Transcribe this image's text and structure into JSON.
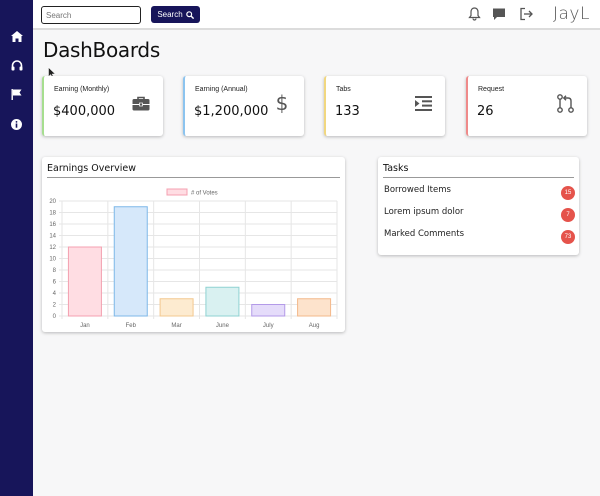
{
  "sidebar": {
    "items": [
      {
        "icon": "home-icon"
      },
      {
        "icon": "headphones-icon"
      },
      {
        "icon": "flag-icon"
      },
      {
        "icon": "info-icon"
      }
    ]
  },
  "topbar": {
    "search_placeholder": "Search",
    "search_button": "Search",
    "user_name": "JayL"
  },
  "page": {
    "title": "DashBoards"
  },
  "cards": [
    {
      "label": "Earning (Monthly)",
      "value": "$400,000",
      "icon": "briefcase-icon",
      "accent": "#a6de8f"
    },
    {
      "label": "Earning (Annual)",
      "value": "$1,200,000",
      "icon": "dollar-icon",
      "accent": "#8cc4ef"
    },
    {
      "label": "Tabs",
      "value": "133",
      "icon": "indent-icon",
      "accent": "#f1d77f"
    },
    {
      "label": "Request",
      "value": "26",
      "icon": "pull-request-icon",
      "accent": "#ef8a8a"
    }
  ],
  "earnings": {
    "title": "Earnings Overview"
  },
  "tasks": {
    "title": "Tasks",
    "items": [
      {
        "label": "Borrowed Items",
        "badge": "15"
      },
      {
        "label": "Lorem ipsum dolor",
        "badge": "7"
      },
      {
        "label": "Marked Comments",
        "badge": "73"
      }
    ]
  },
  "colors": {
    "sidebar": "#17155a",
    "badge": "#e5534b"
  },
  "chart_data": {
    "type": "bar",
    "categories": [
      "Jan",
      "Feb",
      "Mar",
      "June",
      "July",
      "Aug"
    ],
    "series": [
      {
        "name": "# of Votes",
        "values": [
          12,
          19,
          3,
          5,
          2,
          3
        ]
      }
    ],
    "colors": [
      {
        "fill": "#ffdde3",
        "stroke": "#f4a0b0"
      },
      {
        "fill": "#d6e8fa",
        "stroke": "#7db7e8"
      },
      {
        "fill": "#fdebd0",
        "stroke": "#f3c88f"
      },
      {
        "fill": "#d9f1f1",
        "stroke": "#8fd2d2"
      },
      {
        "fill": "#e5dcfa",
        "stroke": "#b39ae8"
      },
      {
        "fill": "#fde3cc",
        "stroke": "#f3b88a"
      }
    ],
    "yticks": [
      "0",
      "2",
      "4",
      "6",
      "8",
      "10",
      "12",
      "14",
      "16",
      "18",
      "20"
    ],
    "ylim": [
      0,
      20
    ],
    "grid": true,
    "legend": "top"
  }
}
